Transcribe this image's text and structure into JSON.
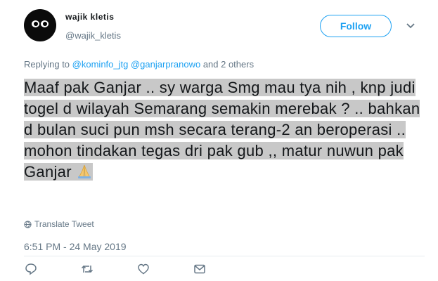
{
  "author": {
    "name": "wajik kletis",
    "handle": "@wajik_kletis"
  },
  "follow_button": {
    "label": "Follow"
  },
  "icons": {
    "more": "chevron-down-icon",
    "translate": "globe-icon",
    "actions": [
      "reply-icon",
      "retweet-icon",
      "like-icon",
      "message-icon"
    ]
  },
  "reply_context": {
    "prefix": "Replying to",
    "mentions": [
      "@kominfo_jtg",
      "@ganjarpranowo"
    ],
    "suffix": "and 2 others"
  },
  "tweet": {
    "text": "Maaf pak Ganjar .. sy warga Smg mau tya nih , knp judi togel d wilayah Semarang semakin merebak ? .. bahkan d bulan suci pun msh secara terang-2 an beroperasi .. mohon tindakan tegas dri pak gub ,, matur nuwun pak Ganjar",
    "emoji": "folded-hands-emoji"
  },
  "translate": {
    "label": "Translate Tweet"
  },
  "timestamp": "6:51 PM - 24 May 2019",
  "colors": {
    "accent": "#1da1f2",
    "muted": "#657786",
    "highlight": "#c8c8c8"
  }
}
